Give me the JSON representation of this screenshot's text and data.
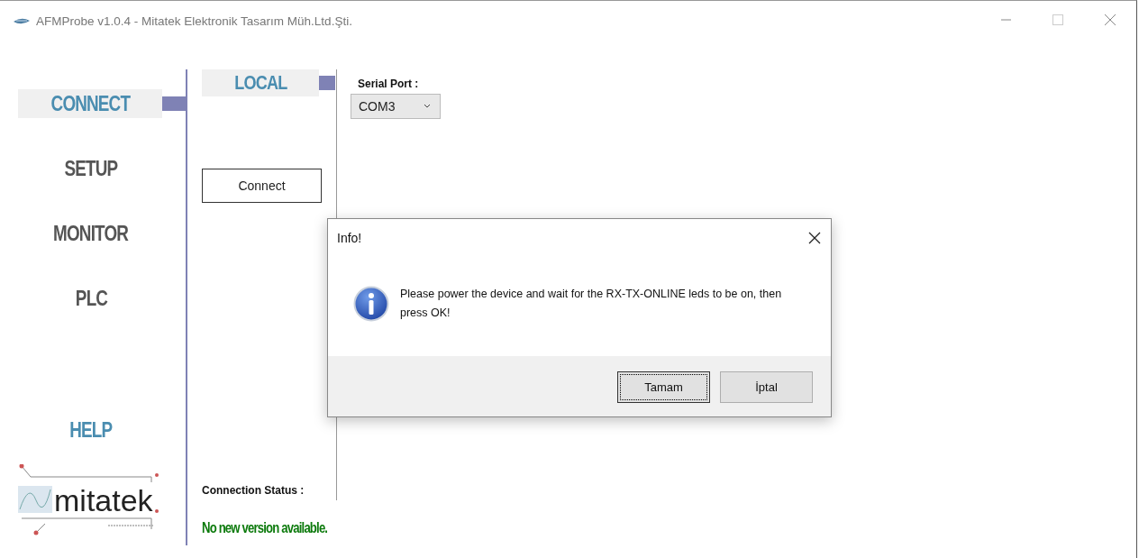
{
  "window": {
    "title": "AFMProbe v1.0.4 - Mitatek Elektronik Tasarım Müh.Ltd.Şti."
  },
  "sidebar": {
    "items": [
      {
        "label": "CONNECT",
        "selected": true,
        "kind": "section"
      },
      {
        "label": "SETUP",
        "selected": false,
        "kind": "section"
      },
      {
        "label": "MONITOR",
        "selected": false,
        "kind": "section"
      },
      {
        "label": "PLC",
        "selected": false,
        "kind": "section"
      },
      {
        "label": "HELP",
        "selected": false,
        "kind": "help"
      }
    ],
    "logo": {
      "text": "mitatek"
    }
  },
  "subnav": {
    "items": [
      {
        "label": "LOCAL",
        "selected": true
      }
    ]
  },
  "connect_button": "Connect",
  "connection_status_label": "Connection Status :",
  "version_message": "No new version available.",
  "serial_port": {
    "label": "Serial Port :",
    "value": "COM3"
  },
  "dialog": {
    "title": "Info!",
    "message": "Please power the device and wait for the RX-TX-ONLINE leds to be on, then press OK!",
    "buttons": [
      {
        "label": "Tamam",
        "default": true
      },
      {
        "label": "İptal",
        "default": false
      }
    ]
  }
}
